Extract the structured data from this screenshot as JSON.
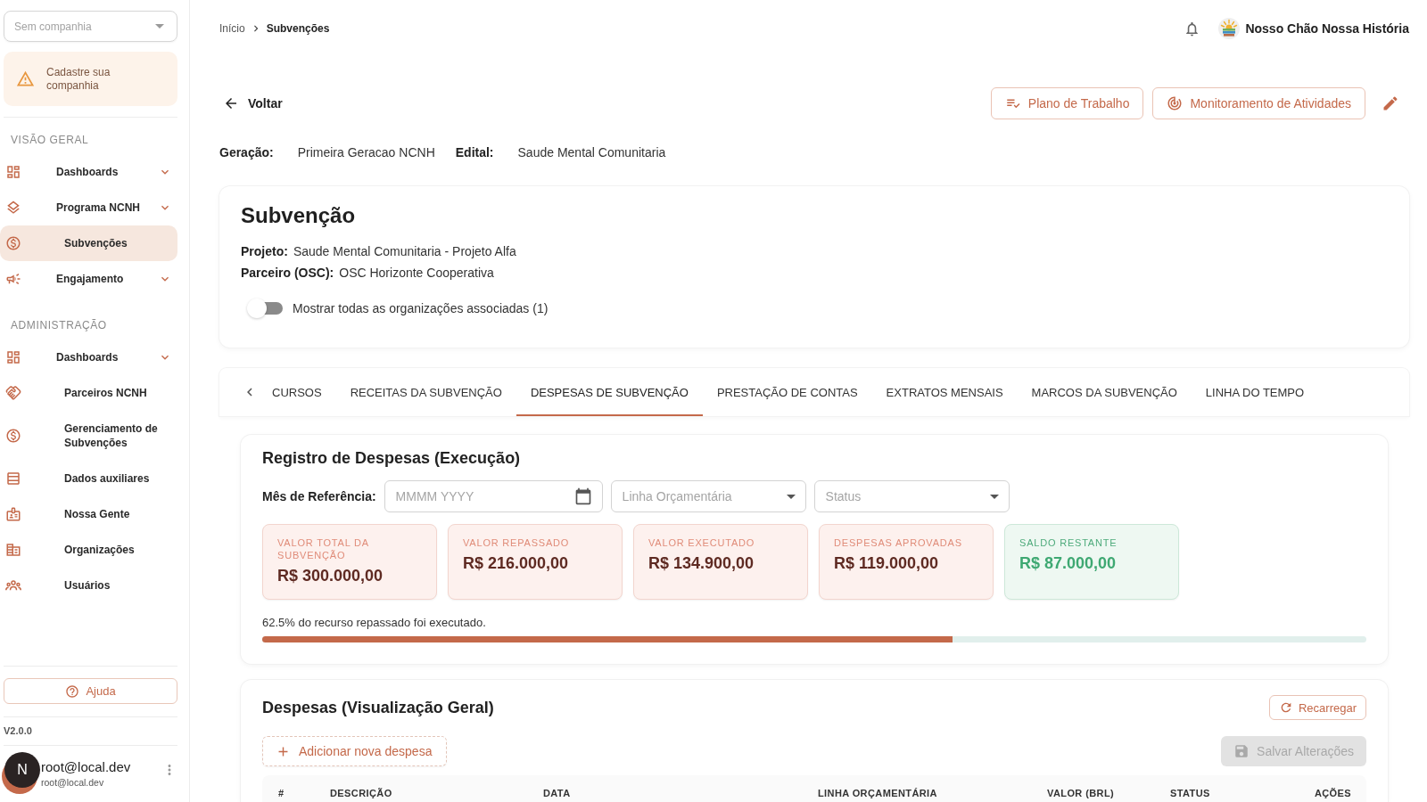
{
  "sidebar": {
    "company_select": {
      "placeholder": "Sem companhia"
    },
    "notice": "Cadastre sua companhia",
    "sections": [
      {
        "title": "VISÃO GERAL",
        "items": [
          {
            "label": "Dashboards",
            "selected": false,
            "expanded": false
          },
          {
            "label": "Programa NCNH",
            "selected": false,
            "expanded": false
          },
          {
            "label": "Subvenções",
            "selected": true
          },
          {
            "label": "Engajamento",
            "selected": false,
            "expanded": false
          }
        ]
      },
      {
        "title": "ADMINISTRAÇÃO",
        "items": [
          {
            "label": "Dashboards",
            "selected": false,
            "expanded": false
          },
          {
            "label": "Parceiros NCNH",
            "selected": false
          },
          {
            "label": "Gerenciamento de Subvenções",
            "selected": false
          },
          {
            "label": "Dados auxiliares",
            "selected": false
          },
          {
            "label": "Nossa Gente",
            "selected": false
          },
          {
            "label": "Organizações",
            "selected": false
          },
          {
            "label": "Usuários",
            "selected": false
          }
        ]
      }
    ],
    "help_button": "Ajuda",
    "version": "V2.0.0",
    "user": {
      "initial": "N",
      "name": "root@local.dev",
      "email": "root@local.dev"
    }
  },
  "breadcrumb": [
    {
      "label": "Início",
      "current": false
    },
    {
      "label": "Subvenções",
      "current": true
    }
  ],
  "header": {
    "organization": "Nosso Chão Nossa História"
  },
  "back_link": "Voltar",
  "actions": [
    "Plano de Trabalho",
    "Monitoramento de Atividades"
  ],
  "meta": [
    {
      "label": "Geração:",
      "value": "Primeira Geracao NCNH"
    },
    {
      "label": "Edital:",
      "value": "Saude Mental Comunitaria"
    }
  ],
  "summary": {
    "title": "Subvenção",
    "fields": [
      {
        "label": "Projeto:",
        "value": "Saude Mental Comunitaria - Projeto Alfa"
      },
      {
        "label": "Parceiro (OSC):",
        "value": "OSC Horizonte Cooperativa"
      }
    ],
    "toggle": {
      "label": "Mostrar todas as organizações associadas (1)",
      "on": false
    }
  },
  "tabs": [
    {
      "label": "CURSOS",
      "selected": false
    },
    {
      "label": "RECEITAS DA SUBVENÇÃO",
      "selected": false
    },
    {
      "label": "DESPESAS DE SUBVENÇÃO",
      "selected": true
    },
    {
      "label": "PRESTAÇÃO DE CONTAS",
      "selected": false
    },
    {
      "label": "EXTRATOS MENSAIS",
      "selected": false
    },
    {
      "label": "MARCOS DA SUBVENÇÃO",
      "selected": false
    },
    {
      "label": "LINHA DO TEMPO",
      "selected": false
    }
  ],
  "expense_register": {
    "title": "Registro de Despesas (Execução)",
    "filter_label": "Mês de Referência:",
    "filters": [
      {
        "kind": "date",
        "placeholder": "MMMM YYYY"
      },
      {
        "kind": "select",
        "placeholder": "Linha Orçamentária"
      },
      {
        "kind": "select",
        "placeholder": "Status"
      }
    ],
    "stats": [
      {
        "kind": "amount",
        "label": "VALOR TOTAL DA SUBVENÇÃO",
        "value": "R$ 300.000,00"
      },
      {
        "kind": "amount",
        "label": "VALOR REPASSADO",
        "value": "R$ 216.000,00"
      },
      {
        "kind": "amount",
        "label": "VALOR EXECUTADO",
        "value": "R$ 134.900,00"
      },
      {
        "kind": "amount",
        "label": "DESPESAS APROVADAS",
        "value": "R$ 119.000,00"
      },
      {
        "kind": "balance",
        "label": "SALDO RESTANTE",
        "value": "R$ 87.000,00"
      }
    ],
    "progress": {
      "caption": "62.5% do recurso repassado foi executado.",
      "level": 0.625
    }
  },
  "expenses": {
    "title": "Despesas (Visualização Geral)",
    "reload_button": "Recarregar",
    "add_button": "Adicionar nova despesa",
    "save_button": {
      "label": "Salvar Alterações",
      "disabled": true
    },
    "table": {
      "columns": [
        "#",
        "DESCRIÇÃO",
        "DATA",
        "LINHA ORÇAMENTÁRIA",
        "VALOR (BRL)",
        "STATUS",
        "AÇÕES"
      ]
    }
  }
}
